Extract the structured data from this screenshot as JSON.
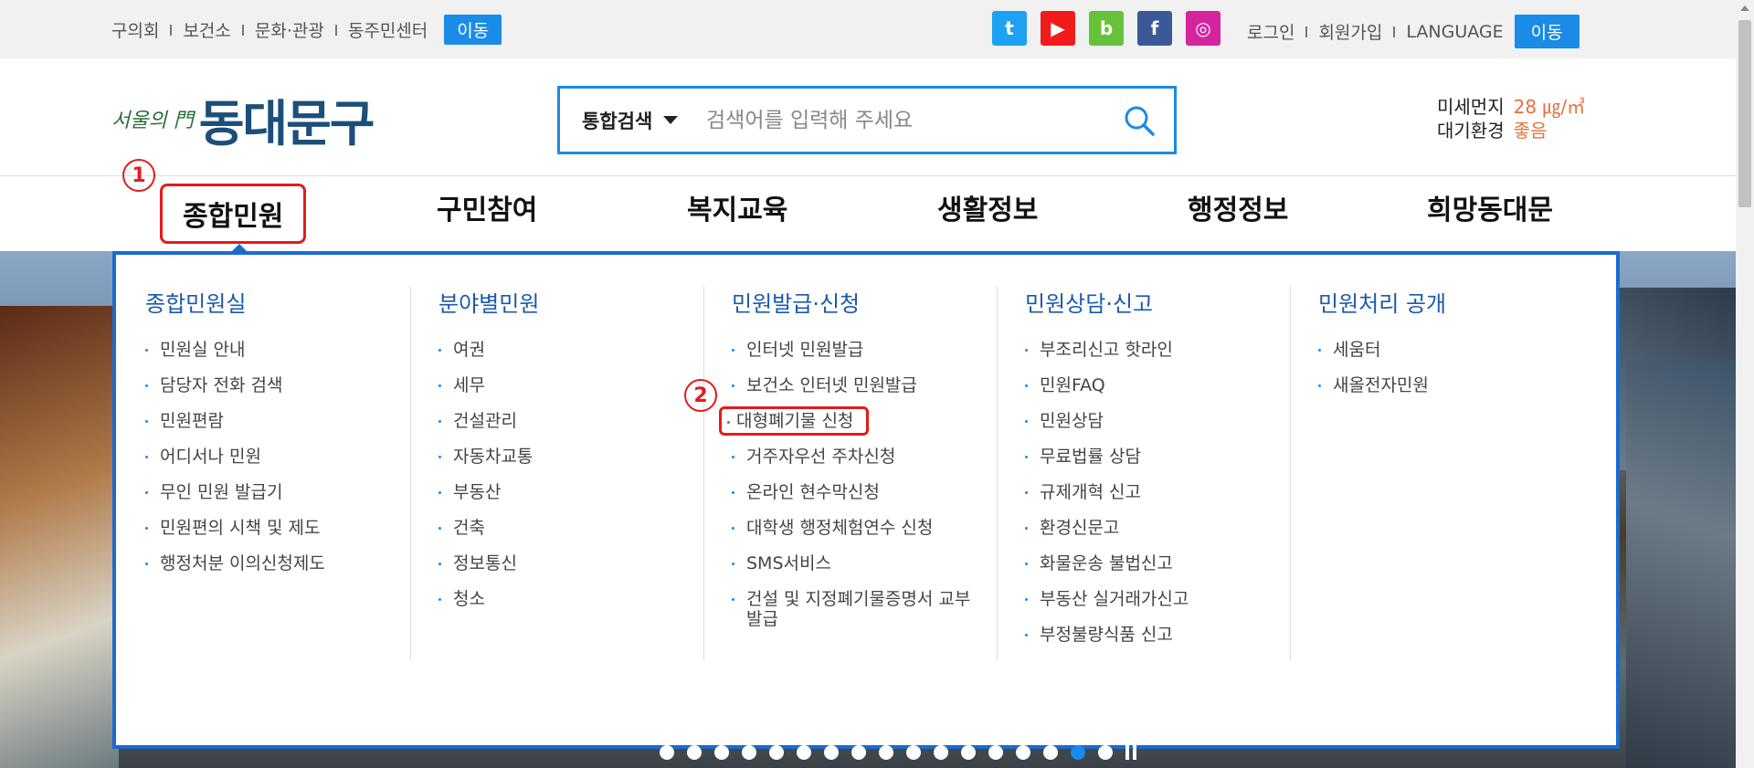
{
  "topbar": {
    "links": [
      "구의회",
      "보건소",
      "문화·관광",
      "동주민센터"
    ],
    "go_label": "이동",
    "sns": [
      {
        "icon": "twitter-icon",
        "glyph": "t",
        "color": "#1da1f2"
      },
      {
        "icon": "youtube-icon",
        "glyph": "▶",
        "color": "#f21b1b"
      },
      {
        "icon": "blog-icon",
        "glyph": "b",
        "color": "#67c23a"
      },
      {
        "icon": "facebook-icon",
        "glyph": "f",
        "color": "#3b5998"
      },
      {
        "icon": "instagram-icon",
        "glyph": "◎",
        "color": "#d6249f"
      }
    ],
    "login": "로그인",
    "signup": "회원가입",
    "language": "LANGUAGE",
    "language_go": "이동"
  },
  "logo": {
    "small": "서울의 門",
    "big": "동대문구"
  },
  "search": {
    "scope": "통합검색",
    "placeholder": "검색어를 입력해 주세요",
    "icon": "search-icon"
  },
  "air": {
    "dust_label": "미세먼지",
    "dust_value": "28 ㎍/㎥",
    "env_label": "대기환경",
    "env_value": "좋음"
  },
  "nav": [
    "종합민원",
    "구민참여",
    "복지교육",
    "생활정보",
    "행정정보",
    "희망동대문"
  ],
  "mega": [
    {
      "title": "종합민원실",
      "items": [
        "민원실 안내",
        "담당자 전화 검색",
        "민원편람",
        "어디서나 민원",
        "무인 민원 발급기",
        "민원편의 시책 및 제도",
        "행정처분 이의신청제도"
      ]
    },
    {
      "title": "분야별민원",
      "items": [
        "여권",
        "세무",
        "건설관리",
        "자동차교통",
        "부동산",
        "건축",
        "정보통신",
        "청소"
      ]
    },
    {
      "title": "민원발급·신청",
      "items": [
        "인터넷 민원발급",
        "보건소 인터넷 민원발급",
        "대형폐기물 신청",
        "거주자우선 주차신청",
        "온라인 현수막신청",
        "대학생 행정체험연수 신청",
        "SMS서비스",
        "건설 및 지정폐기물증명서 교부발급"
      ]
    },
    {
      "title": "민원상담·신고",
      "items": [
        "부조리신고 핫라인",
        "민원FAQ",
        "민원상담",
        "무료법률 상담",
        "규제개혁 신고",
        "환경신문고",
        "화물운송 불법신고",
        "부동산 실거래가신고",
        "부정불량식품 신고"
      ]
    },
    {
      "title": "민원처리 공개",
      "items": [
        "세움터",
        "새올전자민원"
      ]
    }
  ],
  "annotations": {
    "one": "1",
    "two": "2"
  }
}
